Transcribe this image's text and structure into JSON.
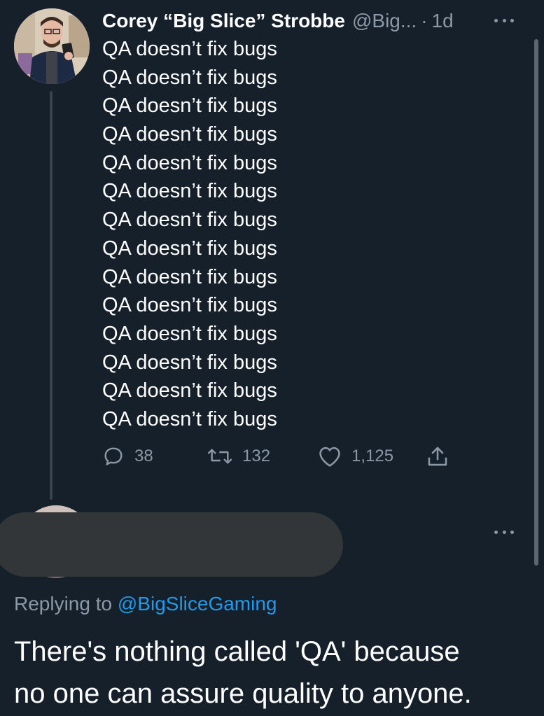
{
  "tweet": {
    "author": {
      "display_name": "Corey “Big Slice” Strobbe",
      "handle": "@Big...",
      "separator": "·",
      "time": "1d"
    },
    "lines": [
      "QA doesn’t fix bugs",
      "QA doesn’t fix bugs",
      "QA doesn’t fix bugs",
      "QA doesn’t fix bugs",
      "QA doesn’t fix bugs",
      "QA doesn’t fix bugs",
      "QA doesn’t fix bugs",
      "QA doesn’t fix bugs",
      "QA doesn’t fix bugs",
      "QA doesn’t fix bugs",
      "QA doesn’t fix bugs",
      "QA doesn’t fix bugs",
      "QA doesn’t fix bugs",
      "QA doesn’t fix bugs"
    ],
    "actions": {
      "reply": {
        "icon": "reply-icon",
        "count": "38"
      },
      "retweet": {
        "icon": "retweet-icon",
        "count": "132"
      },
      "like": {
        "icon": "heart-icon",
        "count": "1,125"
      },
      "share": {
        "icon": "share-icon"
      }
    },
    "more_icon": "more-horizontal-icon"
  },
  "reply": {
    "replying_to_prefix": "Replying to ",
    "replying_to_handle": "@BigSliceGaming",
    "lines": [
      "There's nothing called 'QA' because",
      "no one can assure quality to anyone."
    ],
    "more_icon": "more-horizontal-icon"
  },
  "colors": {
    "background": "#15202b",
    "primary_text": "#ffffff",
    "secondary_text": "#8b98a5",
    "link": "#1d9bf0",
    "thread_line": "#38444d",
    "redaction": "#333638"
  }
}
